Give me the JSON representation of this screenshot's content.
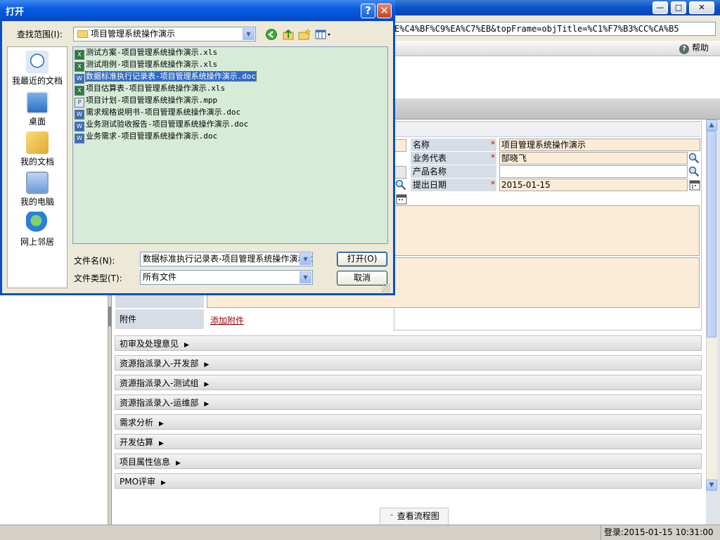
{
  "background": {
    "url_text": "E%C4%BF%C9%EA%C7%EB&topFrame=objTitle=%C1%F7%B3%CC%CA%B5",
    "help_label": "帮助",
    "form": {
      "fields": [
        {
          "label": "名称",
          "value": "项目管理系统操作演示",
          "required": true
        },
        {
          "label": "业务代表",
          "value": "郜晓飞",
          "required": true
        },
        {
          "label": "产品名称",
          "value": "",
          "required": false
        },
        {
          "label": "提出日期",
          "value": "2015-01-15",
          "required": true
        }
      ],
      "attachment_label": "附件",
      "attachment_link": "添加附件"
    },
    "sections": [
      "初审及处理意见",
      "资源指派录入-开发部",
      "资源指派录入-测试组",
      "资源指派录入-运维部",
      "需求分析",
      "开发估算",
      "项目属性信息",
      "PMO评审"
    ],
    "flow_button": "查看流程图",
    "status": "登录:2015-01-15 10:31:00"
  },
  "dialog": {
    "title": "打开",
    "lookin_label": "查找范围(I):",
    "lookin_value": "项目管理系统操作演示",
    "places": [
      "我最近的文档",
      "桌面",
      "我的文档",
      "我的电脑",
      "网上邻居"
    ],
    "files": [
      {
        "name": "测试方案-项目管理系统操作演示.xls",
        "type": "xls",
        "selected": false
      },
      {
        "name": "测试用例-项目管理系统操作演示.xls",
        "type": "xls",
        "selected": false
      },
      {
        "name": "数据标准执行记录表-项目管理系统操作演示.doc",
        "type": "doc",
        "selected": true
      },
      {
        "name": "项目估算表-项目管理系统操作演示.xls",
        "type": "xls",
        "selected": false
      },
      {
        "name": "项目计划-项目管理系统操作演示.mpp",
        "type": "mpp",
        "selected": false
      },
      {
        "name": "需求规格说明书-项目管理系统操作演示.doc",
        "type": "doc",
        "selected": false
      },
      {
        "name": "业务测试验收报告-项目管理系统操作演示.doc",
        "type": "doc",
        "selected": false
      },
      {
        "name": "业务需求-项目管理系统操作演示.doc",
        "type": "doc",
        "selected": false
      }
    ],
    "filename_label": "文件名(N):",
    "filename_value": "数据标准执行记录表-项目管理系统操作演示.doc",
    "filetype_label": "文件类型(T):",
    "filetype_value": "所有文件",
    "open_label": "打开(O)",
    "cancel_label": "取消"
  }
}
